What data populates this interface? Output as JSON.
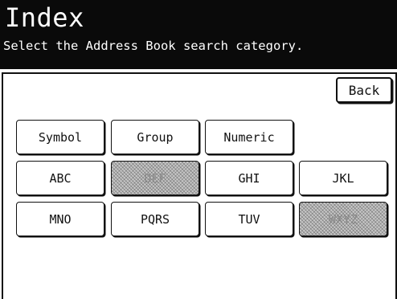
{
  "header": {
    "title": "Index",
    "subtitle": "Select the Address Book search category."
  },
  "back_button": {
    "label": "Back"
  },
  "categories": {
    "symbol": "Symbol",
    "group": "Group",
    "numeric": "Numeric",
    "abc": "ABC",
    "def": "DEF",
    "ghi": "GHI",
    "jkl": "JKL",
    "mno": "MNO",
    "pqrs": "PQRS",
    "tuv": "TUV",
    "wxyz": "WXYZ"
  },
  "disabled": [
    "DEF",
    "WXYZ"
  ]
}
